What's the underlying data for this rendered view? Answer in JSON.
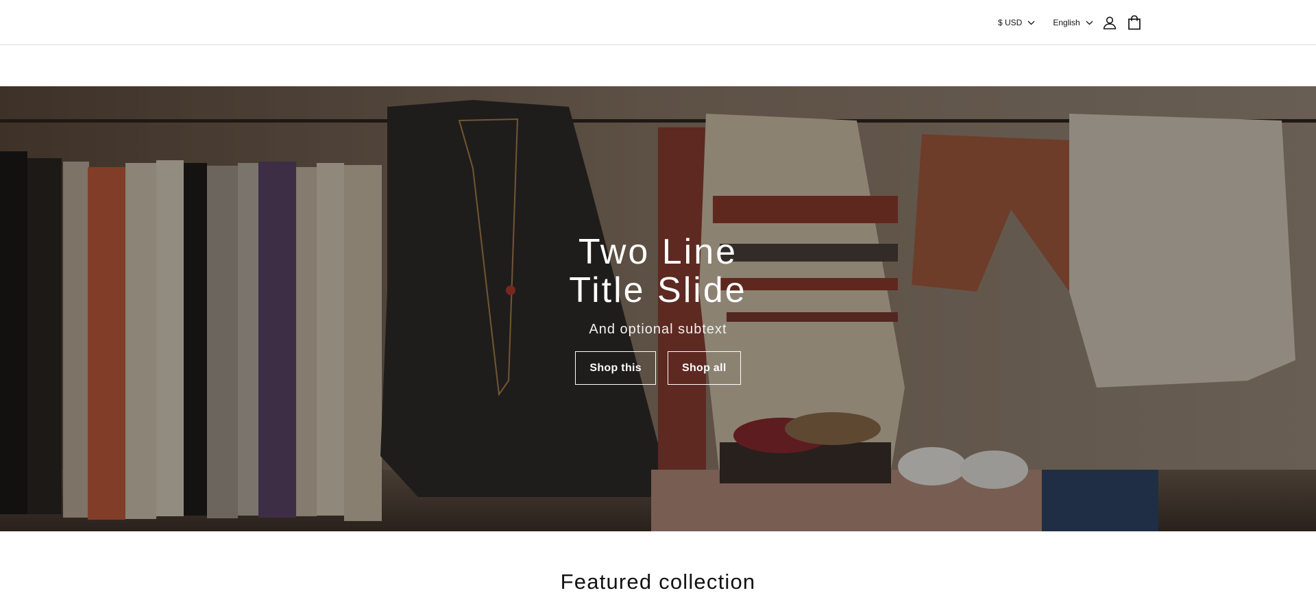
{
  "header": {
    "currency": {
      "label": "$ USD",
      "icon": "chevron-down-icon"
    },
    "language": {
      "label": "English",
      "icon": "chevron-down-icon"
    },
    "account_icon": "account-icon",
    "cart_icon": "cart-icon"
  },
  "hero": {
    "title_line1": "Two Line",
    "title_line2": "Title Slide",
    "subtext": "And optional subtext",
    "buttons": [
      {
        "label": "Shop this"
      },
      {
        "label": "Shop all"
      }
    ],
    "overlay_color": "#000000"
  },
  "featured": {
    "title": "Featured collection"
  },
  "colors": {
    "text": "#121212",
    "background": "#ffffff",
    "hero_text": "#ffffff"
  }
}
